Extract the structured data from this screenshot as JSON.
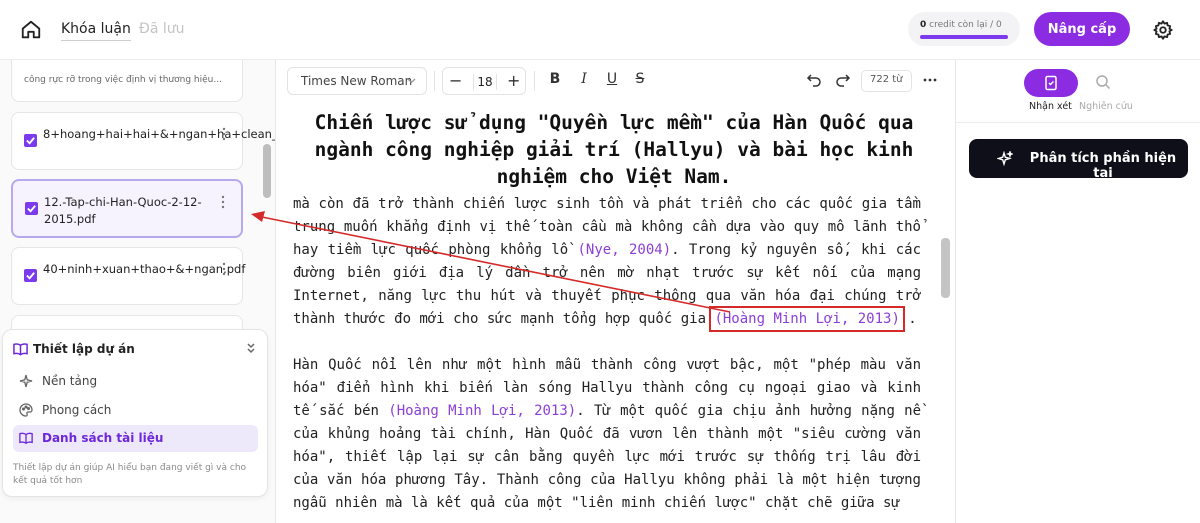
{
  "topbar": {
    "tab_thesis": "Khóa luận",
    "tab_saved": "Đã lưu",
    "credits_value": "0",
    "credits_label": "credit còn lại",
    "credits_total": "/ 0",
    "upgrade_label": "Nâng cấp"
  },
  "documents": {
    "snippet": "công rực rỡ trong việc định vị thương hiệu...",
    "items": [
      {
        "name": "8+hoang+hai+hai+&+ngan+ha+clean_OK.pdf"
      },
      {
        "name": "12.-Tap-chi-Han-Quoc-2-12-2015.pdf"
      },
      {
        "name": "40+ninh+xuan+thao+&+ngan.pdf"
      }
    ]
  },
  "setup": {
    "title": "Thiết lập dự án",
    "menu": [
      {
        "label": "Nền tảng"
      },
      {
        "label": "Phong cách"
      },
      {
        "label": "Danh sách tài liệu"
      }
    ],
    "description": "Thiết lập dự án giúp AI hiểu bạn đang viết gì và cho kết quả tốt hơn"
  },
  "toolbar": {
    "font": "Times New Roman",
    "font_size": "18",
    "minus": "−",
    "plus": "+",
    "bold": "B",
    "italic": "I",
    "underline": "U",
    "strike": "S",
    "word_count": "722 từ"
  },
  "document": {
    "title": "Chiến lược sử dụng \"Quyền lực mềm\" của Hàn Quốc qua ngành công nghiệp giải trí (Hallyu) và bài học kinh nghiệm cho Việt Nam.",
    "p1_a": "mà còn đã trở thành chiến lược sinh tồn và phát triển cho các quốc gia tầm trung muốn khẳng định vị thế toàn cầu mà không cần dựa vào quy mô lãnh thổ hay tiềm lực quốc phòng khổng lồ ",
    "p1_cite1": "(Nye, 2004)",
    "p1_b": ". Trong kỷ nguyên số, khi các đường biên giới địa lý dần trở nên mờ nhạt trước sự kết nối của mạng Internet, năng lực thu hút và thuyết phục thông qua văn hóa đại chúng trở thành thước đo mới cho sức mạnh tổng hợp quốc gia ",
    "p1_cite2": "(Hoàng Minh Lợi, 2013)",
    "p1_c": " .",
    "p2_a": "Hàn Quốc nổi lên như một hình mẫu thành công vượt bậc, một \"phép màu văn hóa\" điển hình khi biến làn sóng Hallyu thành công cụ ngoại giao và kinh tế sắc bén ",
    "p2_cite": "(Hoàng Minh Lợi, 2013)",
    "p2_b": ". Từ một quốc gia chịu ảnh hưởng nặng nề của khủng hoảng tài chính, Hàn Quốc đã vươn lên thành một \"siêu cường văn hóa\", thiết lập lại sự cân bằng quyền lực mới trước sự thống trị lâu đời của văn hóa phương Tây. Thành công của Hallyu không phải là một hiện tượng ngẫu nhiên mà là kết quả của một \"liên minh chiến lược\" chặt chẽ giữa sự"
  },
  "right_panel": {
    "tab_comments": "Nhận xét",
    "tab_research": "Nghiên cứu",
    "analyze_label": "Phân tích phần hiện tại"
  },
  "colors": {
    "accent": "#8b2be2",
    "citation": "#8b3fd6",
    "highlight": "#d42a2a"
  }
}
